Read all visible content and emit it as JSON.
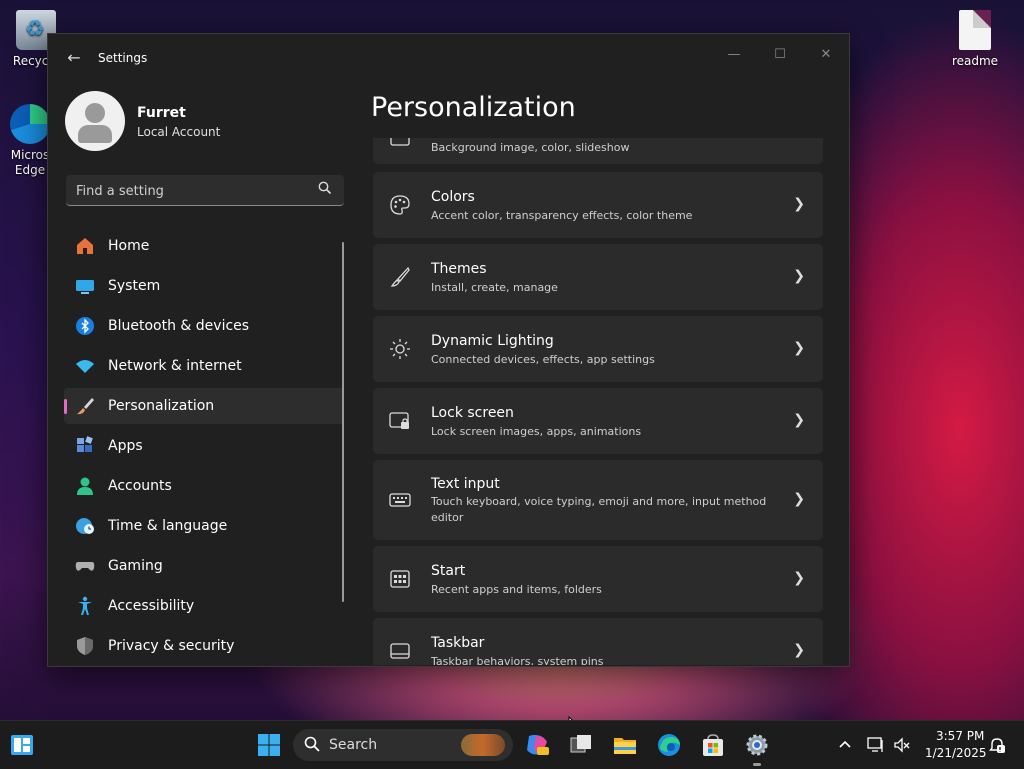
{
  "desktop": {
    "recycle_label": "Recycle",
    "edge_label": "Micros Edge",
    "readme_label": "readme"
  },
  "window": {
    "title": "Settings",
    "minimize": "—",
    "maximize": "☐",
    "close": "✕",
    "back": "←"
  },
  "profile": {
    "name": "Furret",
    "account_type": "Local Account"
  },
  "search": {
    "placeholder": "Find a setting"
  },
  "nav": [
    {
      "label": "Home",
      "icon": "home-icon",
      "color": "#e8723a"
    },
    {
      "label": "System",
      "icon": "system-icon",
      "color": "#2fa8e8"
    },
    {
      "label": "Bluetooth & devices",
      "icon": "bluetooth-icon",
      "color": "#1a7fe0"
    },
    {
      "label": "Network & internet",
      "icon": "wifi-icon",
      "color": "#3ab8f0"
    },
    {
      "label": "Personalization",
      "icon": "brush-icon",
      "color": "#e0a060",
      "active": true
    },
    {
      "label": "Apps",
      "icon": "apps-icon",
      "color": "#5a8ad8"
    },
    {
      "label": "Accounts",
      "icon": "person-icon",
      "color": "#2ec48a"
    },
    {
      "label": "Time & language",
      "icon": "globe-clock-icon",
      "color": "#3aa0e0"
    },
    {
      "label": "Gaming",
      "icon": "gamepad-icon",
      "color": "#b0b0b0"
    },
    {
      "label": "Accessibility",
      "icon": "accessibility-icon",
      "color": "#3ab0f0"
    },
    {
      "label": "Privacy & security",
      "icon": "shield-icon",
      "color": "#9a9a9a"
    }
  ],
  "page": {
    "title": "Personalization"
  },
  "cards": [
    {
      "title": "",
      "subtitle": "Background image, color, slideshow",
      "icon": "background-icon"
    },
    {
      "title": "Colors",
      "subtitle": "Accent color, transparency effects, color theme",
      "icon": "palette-icon"
    },
    {
      "title": "Themes",
      "subtitle": "Install, create, manage",
      "icon": "paintbrush-icon"
    },
    {
      "title": "Dynamic Lighting",
      "subtitle": "Connected devices, effects, app settings",
      "icon": "lighting-icon"
    },
    {
      "title": "Lock screen",
      "subtitle": "Lock screen images, apps, animations",
      "icon": "lock-screen-icon"
    },
    {
      "title": "Text input",
      "subtitle": "Touch keyboard, voice typing, emoji and more, input method editor",
      "icon": "keyboard-icon"
    },
    {
      "title": "Start",
      "subtitle": "Recent apps and items, folders",
      "icon": "start-icon"
    },
    {
      "title": "Taskbar",
      "subtitle": "Taskbar behaviors, system pins",
      "icon": "taskbar-icon"
    }
  ],
  "taskbar": {
    "search_label": "Search",
    "time": "3:57 PM",
    "date": "1/21/2025"
  }
}
